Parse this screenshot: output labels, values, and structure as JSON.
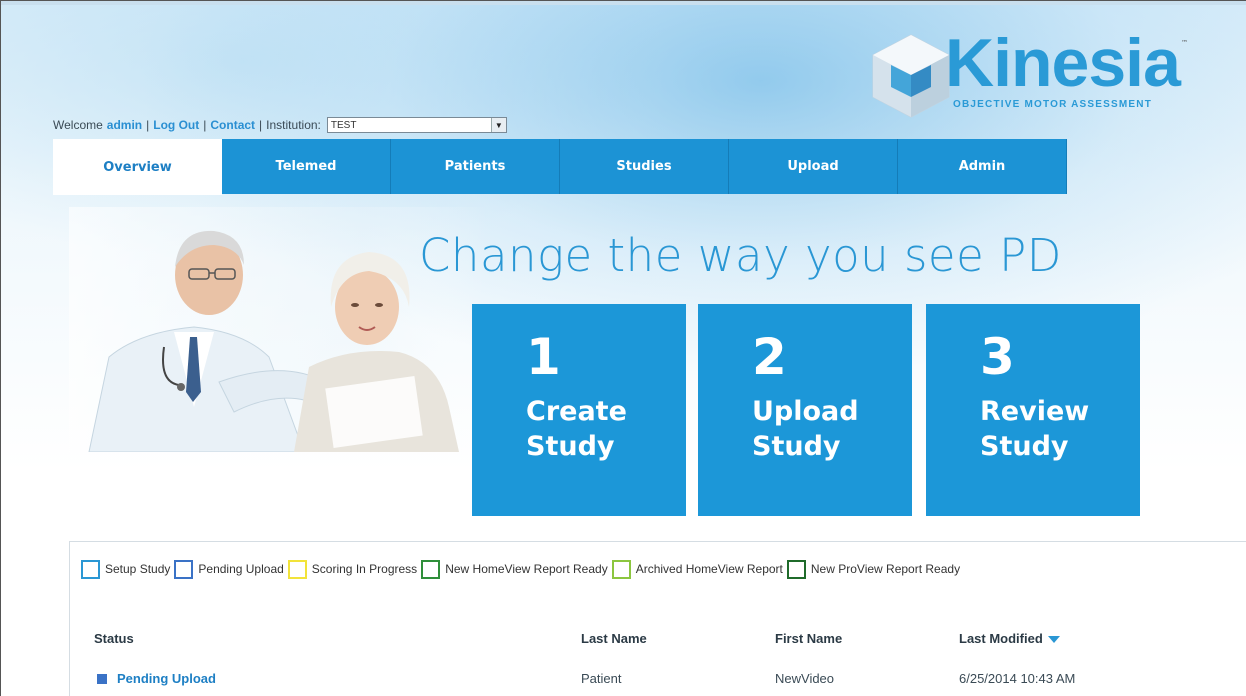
{
  "logo": {
    "word": "Kinesia",
    "tm": "™",
    "tagline": "OBJECTIVE MOTOR ASSESSMENT"
  },
  "userbar": {
    "welcome": "Welcome",
    "username": "admin",
    "logout": "Log Out",
    "contact": "Contact",
    "institution_label": "Institution:",
    "institution_value": "TEST"
  },
  "nav": {
    "tabs": [
      "Overview",
      "Telemed",
      "Patients",
      "Studies",
      "Upload",
      "Admin"
    ],
    "active": "Overview"
  },
  "hero": {
    "title": "Change the way you see PD",
    "steps": [
      {
        "num": "1",
        "text": "Create\nStudy"
      },
      {
        "num": "2",
        "text": "Upload\nStudy"
      },
      {
        "num": "3",
        "text": "Review\nStudy"
      }
    ]
  },
  "legend": [
    {
      "label": "Setup Study",
      "color": "#2a97d4"
    },
    {
      "label": "Pending Upload",
      "color": "#3a72c6"
    },
    {
      "label": "Scoring In Progress",
      "color": "#f2e33a"
    },
    {
      "label": "New HomeView Report Ready",
      "color": "#2f8f3a"
    },
    {
      "label": "Archived HomeView Report",
      "color": "#8cc63f"
    },
    {
      "label": "New ProView Report Ready",
      "color": "#1f6b2a"
    }
  ],
  "table": {
    "headers": {
      "status": "Status",
      "last_name": "Last Name",
      "first_name": "First Name",
      "last_modified": "Last Modified"
    },
    "rows": [
      {
        "status": "Pending Upload",
        "last_name": "Patient",
        "first_name": "NewVideo",
        "last_modified": "6/25/2014 10:43 AM"
      }
    ]
  }
}
